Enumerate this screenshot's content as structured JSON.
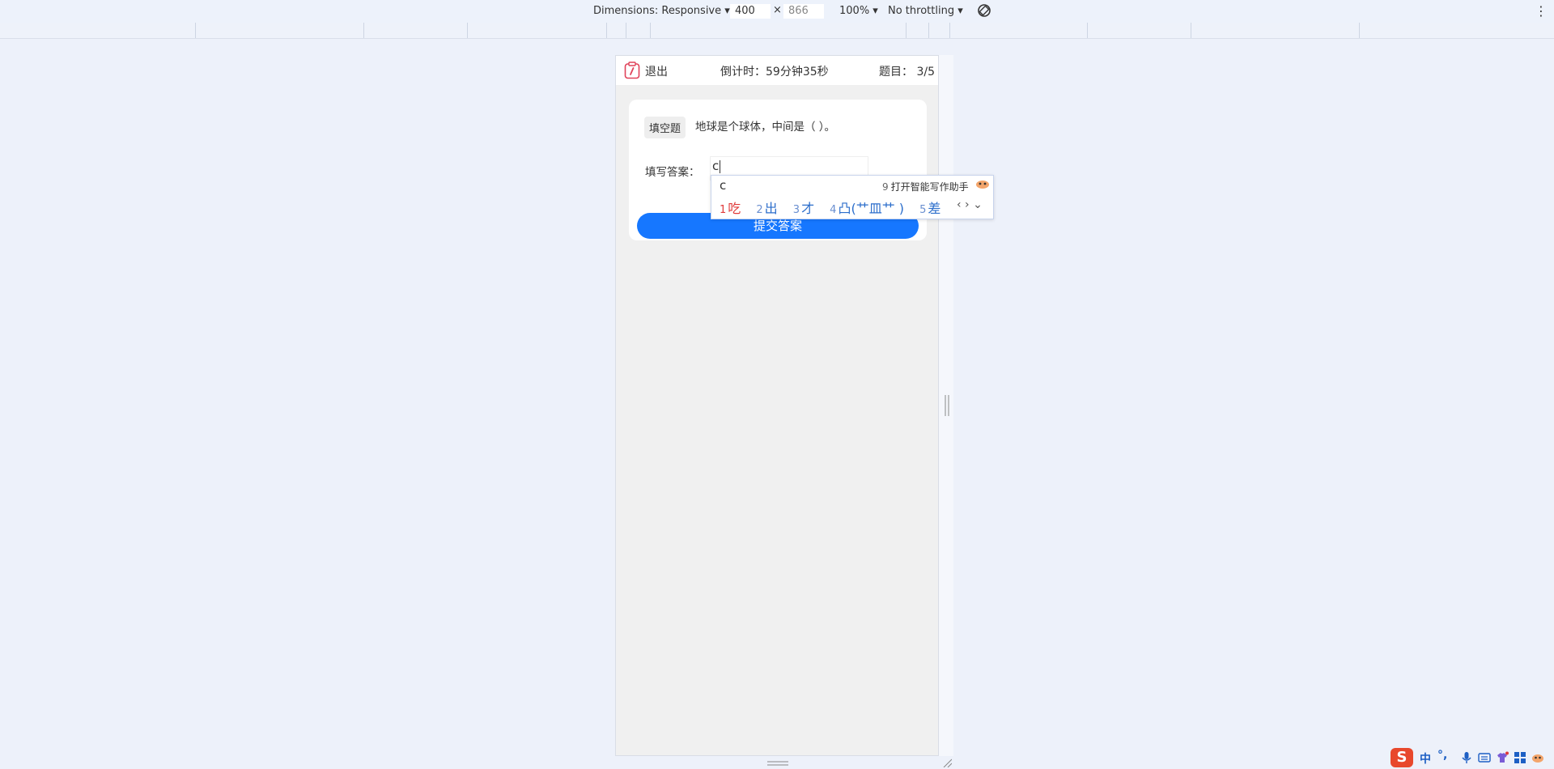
{
  "devtools": {
    "dimensions_label": "Dimensions: Responsive",
    "width": "400",
    "times": "×",
    "height_placeholder": "866",
    "zoom": "100%",
    "throttling": "No throttling",
    "more": "⋮"
  },
  "app": {
    "exit_label": "退出",
    "countdown": "倒计时：59分钟35秒",
    "progress": "题目： 3/5"
  },
  "question": {
    "type_tag": "填空题",
    "text": "地球是个球体，中间是（ ）。",
    "answer_label": "填写答案：",
    "answer_value": "c",
    "submit_label": "提交答案"
  },
  "ime": {
    "composition": "c",
    "assistant_num": "9",
    "assistant_label": "打开智能写作助手",
    "candidates": [
      {
        "n": "1",
        "text": "吃"
      },
      {
        "n": "2",
        "text": "出"
      },
      {
        "n": "3",
        "text": "才"
      },
      {
        "n": "4",
        "text": "凸(艹皿艹 )"
      },
      {
        "n": "5",
        "text": "差"
      }
    ],
    "nav": "‹ › ⌄"
  },
  "tray": {
    "ime_logo": "S",
    "lang": "中",
    "punct": "°,"
  },
  "colors": {
    "primary": "#1677ff",
    "ime_first": "#e03a3a",
    "ime_candidate": "#2c6ecb"
  }
}
